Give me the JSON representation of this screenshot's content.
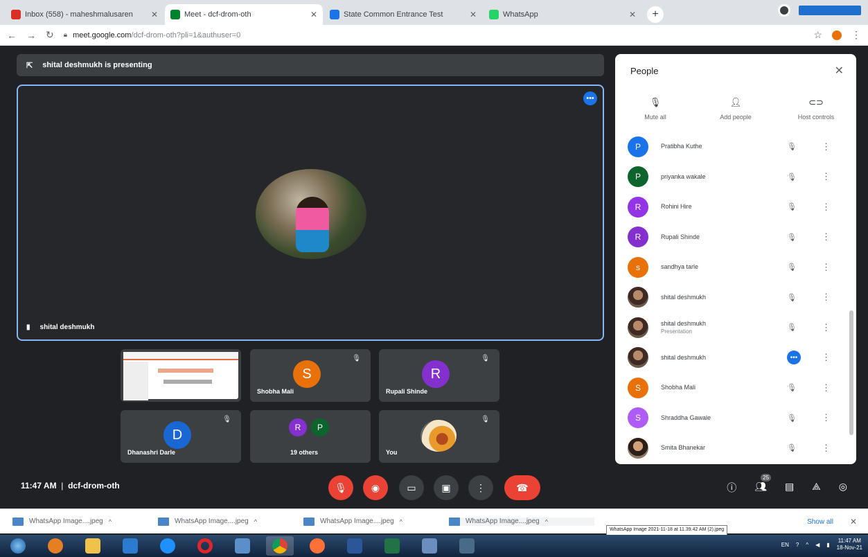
{
  "browser": {
    "tabs": [
      {
        "label": "Inbox (558) - maheshmalusaren",
        "favicon_color": "#d93025",
        "active": false
      },
      {
        "label": "Meet - dcf-drom-oth",
        "favicon_color": "#00832d",
        "active": true
      },
      {
        "label": "State Common Entrance Test",
        "favicon_color": "#1a73e8",
        "active": false
      },
      {
        "label": "WhatsApp",
        "favicon_color": "#25d366",
        "active": false
      }
    ],
    "url_host": "meet.google.com",
    "url_path": "/dcf-drom-oth?pli=1&authuser=0"
  },
  "meet": {
    "presenting_banner": "shital deshmukh is presenting",
    "main_tile_name": "shital deshmukh",
    "tiles": [
      {
        "name": "",
        "kind": "slide"
      },
      {
        "name": "Shobha Mali",
        "initial": "S",
        "color": "#e8710a"
      },
      {
        "name": "Rupali Shinde",
        "initial": "R",
        "color": "#8430ce"
      },
      {
        "name": "Dhanashri Darle",
        "initial": "D",
        "color": "#1967d2"
      },
      {
        "name": "19 others",
        "initial": "R",
        "initial2": "P",
        "color": "#8430ce",
        "color2": "#0d652d"
      },
      {
        "name": "You",
        "kind": "photo"
      }
    ],
    "time": "11:47 AM",
    "separator": "|",
    "meeting_code": "dcf-drom-oth",
    "participant_count": "25"
  },
  "people_panel": {
    "title": "People",
    "actions": [
      "Mute all",
      "Add people",
      "Host controls"
    ],
    "participants": [
      {
        "name": "Pratibha Kuthe",
        "initial": "P",
        "color": "#1a73e8",
        "mic": "off"
      },
      {
        "name": "priyanka wakale",
        "initial": "P",
        "color": "#0d652d",
        "mic": "off"
      },
      {
        "name": "Rohini Hire",
        "initial": "R",
        "color": "#9334e6",
        "mic": "off"
      },
      {
        "name": "Rupali Shinde",
        "initial": "R",
        "color": "#8430ce",
        "mic": "off"
      },
      {
        "name": "sandhya tarle",
        "initial": "s",
        "color": "#e8710a",
        "mic": "off"
      },
      {
        "name": "shital deshmukh",
        "initial": "",
        "color": "photo",
        "mic": "off"
      },
      {
        "name": "shital deshmukh",
        "sub": "Presentation",
        "initial": "",
        "color": "photo",
        "mic": "off"
      },
      {
        "name": "shital deshmukh",
        "initial": "",
        "color": "photo",
        "mic": "speaking"
      },
      {
        "name": "Shobha Mali",
        "initial": "S",
        "color": "#e8710a",
        "mic": "off"
      },
      {
        "name": "Shraddha Gawale",
        "initial": "S",
        "color": "#af5cf7",
        "mic": "off"
      },
      {
        "name": "Smita Bhanekar",
        "initial": "",
        "color": "photo2",
        "mic": "off"
      }
    ]
  },
  "downloads": {
    "items": [
      "WhatsApp Image....jpeg",
      "WhatsApp Image....jpeg",
      "WhatsApp Image....jpeg",
      "WhatsApp Image....jpeg"
    ],
    "tooltip": "WhatsApp Image 2021-11-18 at 11.39.42 AM (2).jpeg",
    "show_all": "Show all"
  },
  "taskbar": {
    "lang": "EN",
    "time": "11:47 AM",
    "date": "18-Nov-21"
  }
}
